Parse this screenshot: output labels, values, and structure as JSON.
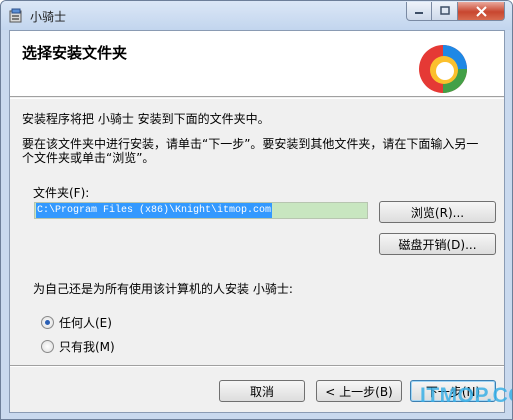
{
  "window": {
    "title": "小骑士",
    "app_icon": "installer-icon",
    "controls": {
      "minimize": "—",
      "maximize": "□",
      "close": "✕"
    }
  },
  "banner": {
    "title": "选择安装文件夹",
    "logo_icon": "product-logo-icon",
    "logo_colors": [
      "#e53935",
      "#fbc02d",
      "#43a047",
      "#1e88e5"
    ]
  },
  "body": {
    "intro": "安装程序将把 小骑士 安装到下面的文件夹中。",
    "instruction_line1": "要在该文件夹中进行安装，请单击“下一步”。要安装到其他文件夹，请在下面输入另一",
    "instruction_line2": "个文件夹或单击“浏览”。",
    "folder_label": "文件夹(F):",
    "folder_value": "C:\\Program Files (x86)\\Knight\\itmop.com",
    "browse_label": "浏览(R)...",
    "disk_cost_label": "磁盘开销(D)...",
    "install_for_label": "为自己还是为所有使用该计算机的人安装 小骑士:",
    "radio_everyone": "任何人(E)",
    "radio_just_me": "只有我(M)",
    "selected_option": "everyone"
  },
  "footer": {
    "cancel_label": "取消",
    "back_label": "< 上一步(B)",
    "next_label": "下一步(N)"
  },
  "watermark": {
    "text": "ITMOP.COM",
    "color": "#3ab0e6"
  }
}
